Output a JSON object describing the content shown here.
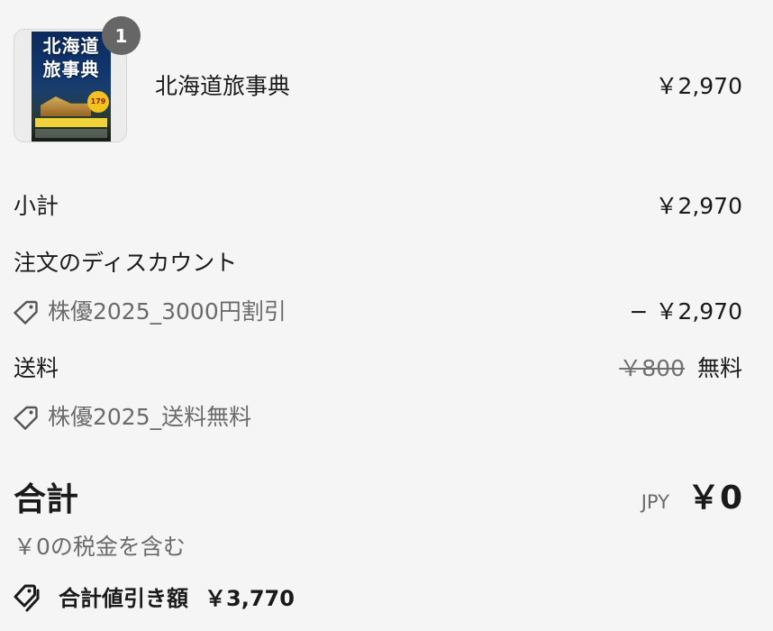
{
  "cart_item": {
    "quantity": "1",
    "name": "北海道旅事典",
    "price": "￥2,970",
    "cover": {
      "title_line1": "北海道",
      "title_line2": "旅事典",
      "badge": "179"
    }
  },
  "summary": {
    "subtotal_label": "小計",
    "subtotal_value": "￥2,970",
    "order_discount_label": "注文のディスカウント",
    "order_discount_code": "株優2025_3000円割引",
    "order_discount_value": "− ￥2,970",
    "shipping_label": "送料",
    "shipping_original": "￥800",
    "shipping_value": "無料",
    "shipping_discount_code": "株優2025_送料無料"
  },
  "total": {
    "label": "合計",
    "currency": "JPY",
    "amount": "￥0",
    "tax_note": "￥0の税金を含む",
    "savings_label": "合計値引き額",
    "savings_amount": "￥3,770"
  },
  "icons": {
    "discount_tag": "tag-icon",
    "savings_tags": "tags-icon"
  },
  "colors": {
    "background": "#f5f5f5",
    "text": "#1a1a1a",
    "muted": "#6b6b6b",
    "badge": "#666666"
  }
}
